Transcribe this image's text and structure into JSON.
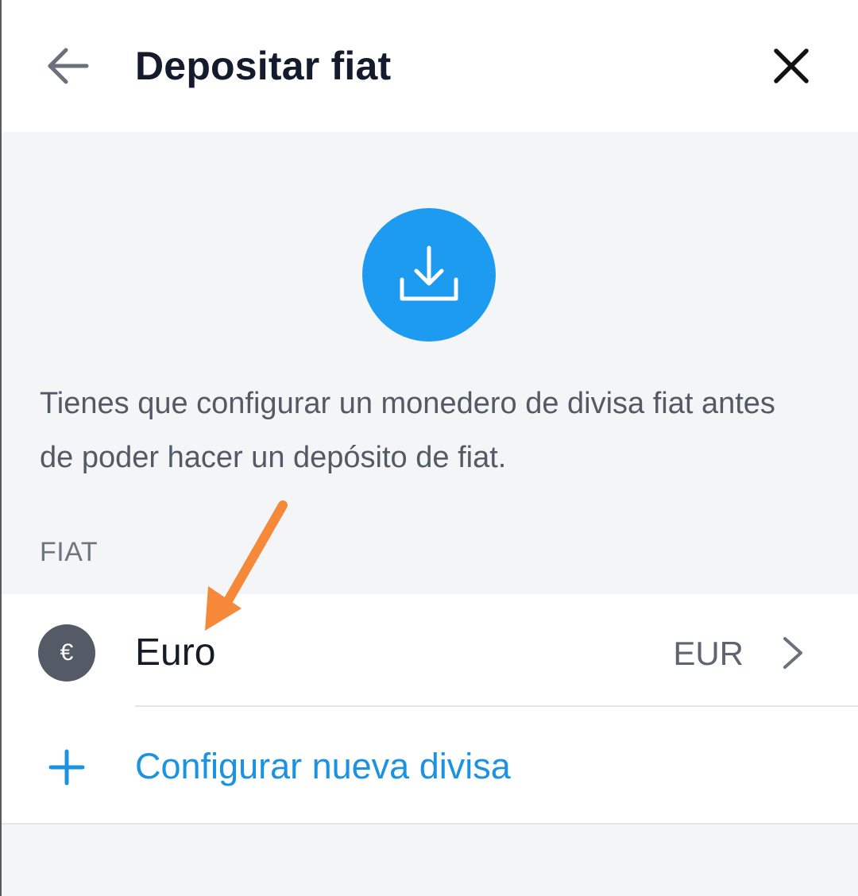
{
  "header": {
    "title": "Depositar fiat",
    "back_icon": "arrow-left-icon",
    "close_icon": "close-icon"
  },
  "hero": {
    "icon": "download-icon",
    "color": "#1c9bf0"
  },
  "message": "Tienes que configurar un monedero de divisa fiat antes de poder hacer un depósito de fiat.",
  "section": {
    "label": "FIAT"
  },
  "currencies": [
    {
      "symbol": "€",
      "name": "Euro",
      "code": "EUR",
      "icon": "chevron-right-icon"
    }
  ],
  "add_currency": {
    "label": "Configurar nueva divisa",
    "icon": "plus-icon",
    "color": "#1c93e0"
  },
  "annotation": {
    "icon": "annotation-arrow-icon",
    "color": "#f6883a"
  }
}
